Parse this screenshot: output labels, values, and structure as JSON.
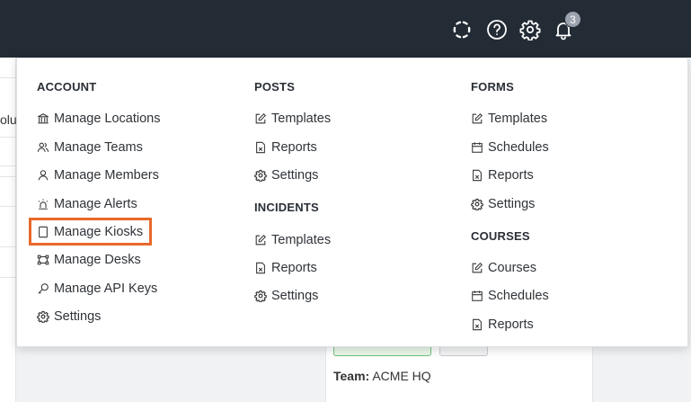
{
  "topbar": {
    "icons": [
      "loading-ring-icon",
      "help-icon",
      "gear-icon",
      "bell-icon"
    ],
    "notification_count": "3"
  },
  "background": {
    "fragment_text": "olut",
    "team_label": "Team:",
    "team_value": "ACME HQ"
  },
  "menu": {
    "account": {
      "title": "ACCOUNT",
      "items": [
        {
          "label": "Manage Locations",
          "icon": "bank-icon"
        },
        {
          "label": "Manage Teams",
          "icon": "users-icon"
        },
        {
          "label": "Manage Members",
          "icon": "user-icon"
        },
        {
          "label": "Manage Alerts",
          "icon": "siren-icon"
        },
        {
          "label": "Manage Kiosks",
          "icon": "tablet-icon"
        },
        {
          "label": "Manage Desks",
          "icon": "desk-icon"
        },
        {
          "label": "Manage API Keys",
          "icon": "key-icon"
        },
        {
          "label": "Settings",
          "icon": "gear-icon"
        }
      ]
    },
    "posts": {
      "title": "POSTS",
      "items": [
        {
          "label": "Templates",
          "icon": "edit-icon"
        },
        {
          "label": "Reports",
          "icon": "report-icon"
        },
        {
          "label": "Settings",
          "icon": "gear-icon"
        }
      ]
    },
    "incidents": {
      "title": "INCIDENTS",
      "items": [
        {
          "label": "Templates",
          "icon": "edit-icon"
        },
        {
          "label": "Reports",
          "icon": "report-icon"
        },
        {
          "label": "Settings",
          "icon": "gear-icon"
        }
      ]
    },
    "forms": {
      "title": "FORMS",
      "items": [
        {
          "label": "Templates",
          "icon": "edit-icon"
        },
        {
          "label": "Schedules",
          "icon": "calendar-icon"
        },
        {
          "label": "Reports",
          "icon": "report-icon"
        },
        {
          "label": "Settings",
          "icon": "gear-icon"
        }
      ]
    },
    "courses": {
      "title": "COURSES",
      "items": [
        {
          "label": "Courses",
          "icon": "edit-icon"
        },
        {
          "label": "Schedules",
          "icon": "calendar-icon"
        },
        {
          "label": "Reports",
          "icon": "report-icon"
        }
      ]
    }
  },
  "colors": {
    "topbar_bg": "#232b35",
    "highlight": "#e8692a"
  }
}
